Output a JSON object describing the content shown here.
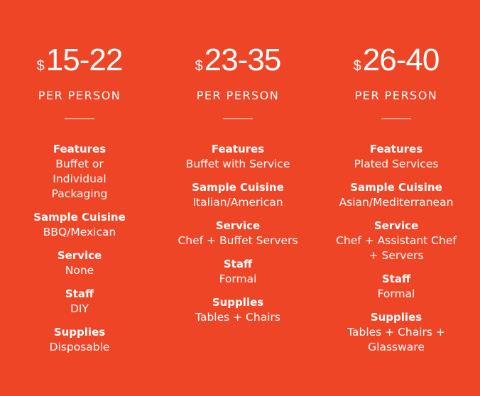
{
  "tiers": [
    {
      "currency": "$",
      "amount": "15-22",
      "unit": "PER PERSON",
      "features_label": "Features",
      "features_value": "Buffet or Individual Packaging",
      "cuisine_label": "Sample Cuisine",
      "cuisine_value": "BBQ/Mexican",
      "service_label": "Service",
      "service_value": "None",
      "staff_label": "Staff",
      "staff_value": "DIY",
      "supplies_label": "Supplies",
      "supplies_value": "Disposable"
    },
    {
      "currency": "$",
      "amount": "23-35",
      "unit": "PER PERSON",
      "features_label": "Features",
      "features_value": "Buffet with Service",
      "cuisine_label": "Sample Cuisine",
      "cuisine_value": "Italian/American",
      "service_label": "Service",
      "service_value": "Chef + Buffet Servers",
      "staff_label": "Staff",
      "staff_value": "Formal",
      "supplies_label": "Supplies",
      "supplies_value": "Tables + Chairs"
    },
    {
      "currency": "$",
      "amount": "26-40",
      "unit": "PER PERSON",
      "features_label": "Features",
      "features_value": "Plated Services",
      "cuisine_label": "Sample Cuisine",
      "cuisine_value": "Asian/Mediterranean",
      "service_label": "Service",
      "service_value": "Chef + Assistant Chef + Servers",
      "staff_label": "Staff",
      "staff_value": "Formal",
      "supplies_label": "Supplies",
      "supplies_value": "Tables + Chairs + Glassware"
    }
  ],
  "colors": {
    "background": "#ef4527",
    "text": "#ffffff"
  }
}
